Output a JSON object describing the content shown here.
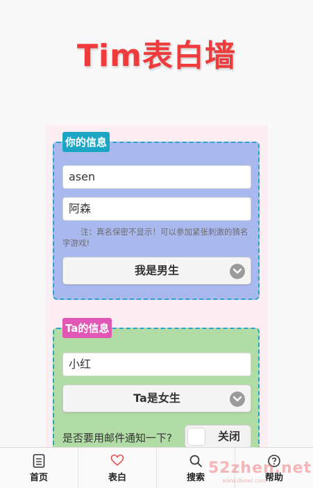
{
  "app_title": "Tim表白墙",
  "your_info": {
    "tag": "你的信息",
    "name_value": "asen",
    "real_name_value": "阿森",
    "note": "注：真名保密不显示！可以参加紧张刺激的猜名字游戏!",
    "gender_selected": "我是男生"
  },
  "ta_info": {
    "tag": "Ta的信息",
    "name_value": "小红",
    "gender_selected": "Ta是女生",
    "notify_label": "是否要用邮件通知一下?",
    "notify_toggle": "关闭"
  },
  "tabs": [
    {
      "label": "首页",
      "icon": "document-icon"
    },
    {
      "label": "表白",
      "icon": "heart-icon"
    },
    {
      "label": "搜索",
      "icon": "search-icon"
    },
    {
      "label": "帮助",
      "icon": "help-icon"
    }
  ],
  "watermark": {
    "text": "52zhen.net",
    "sub": "www.dkewl.com"
  },
  "colors": {
    "title": "#ef3b3b",
    "blue_card": "#a9b9ee",
    "green_card": "#b2dca6",
    "tag_blue": "#1ba6c6",
    "tag_pink": "#e257b6"
  }
}
